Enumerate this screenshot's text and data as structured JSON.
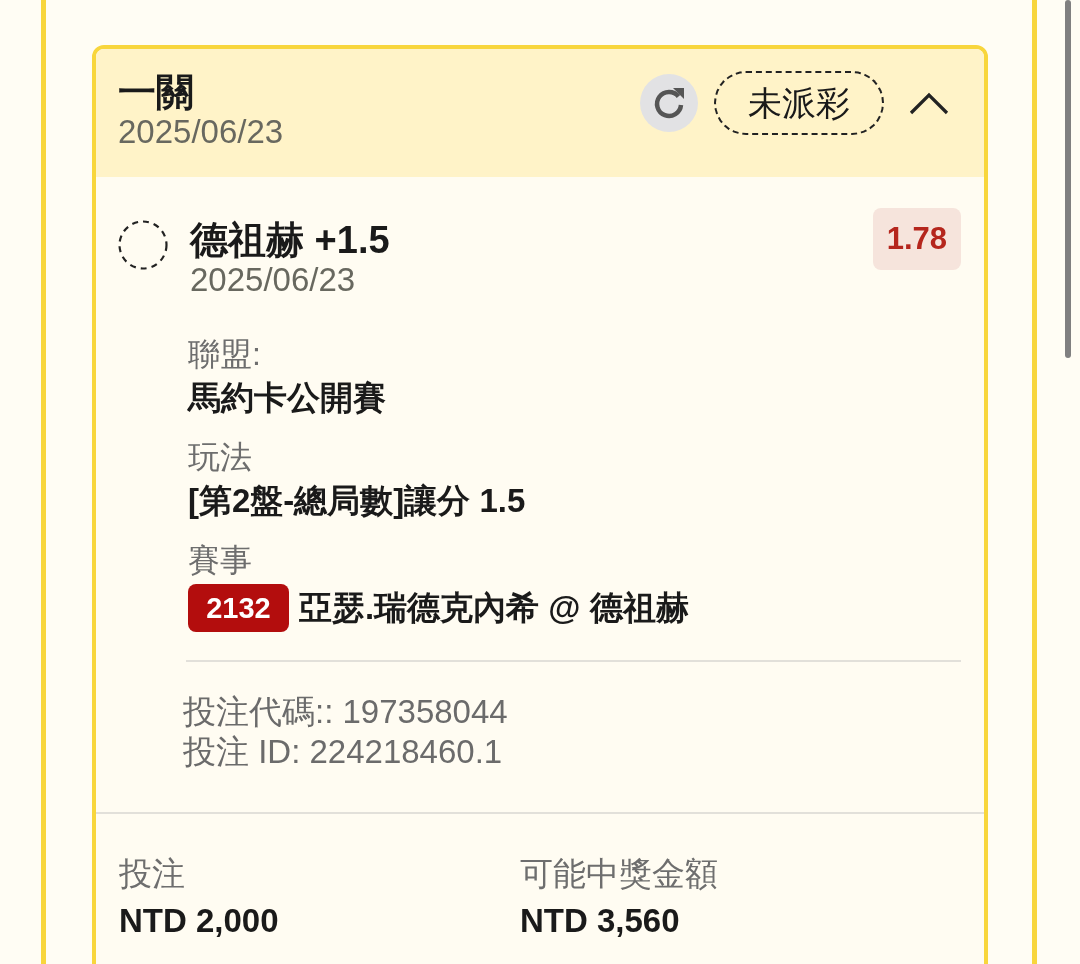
{
  "bet": {
    "title": "一關",
    "date": "2025/06/23",
    "status": "未派彩",
    "expanded": true
  },
  "selection": {
    "name": "德祖赫 +1.5",
    "date": "2025/06/23",
    "odds": "1.78"
  },
  "details": [
    {
      "kind": "text",
      "label": "聯盟:",
      "value": "馬約卡公開賽"
    },
    {
      "kind": "text",
      "label": "玩法",
      "value": "[第2盤-總局數]讓分 1.5"
    },
    {
      "kind": "event",
      "label": "賽事",
      "number": "2132",
      "value": "亞瑟.瑞德克內希 @ 德祖赫"
    }
  ],
  "codes": [
    "投注代碼:: 197358044",
    "投注 ID: 224218460.1"
  ],
  "summary": [
    {
      "label": "投注",
      "value": "NTD 2,000"
    },
    {
      "label": "可能中獎金額",
      "value": "NTD 3,560"
    }
  ]
}
